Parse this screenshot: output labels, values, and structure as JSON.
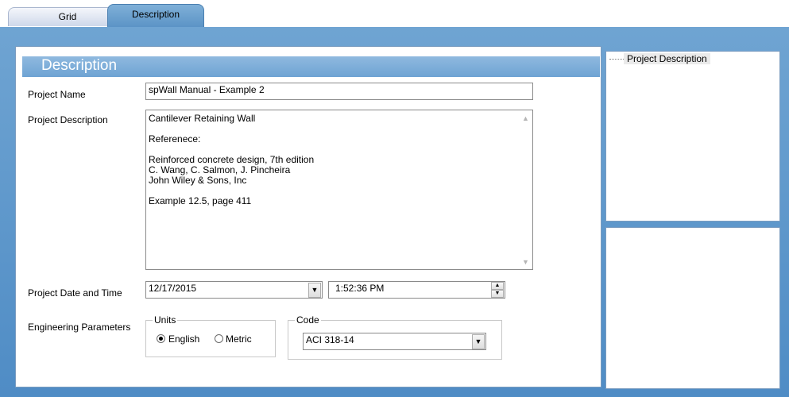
{
  "tabs": [
    {
      "label": "Grid",
      "active": false
    },
    {
      "label": "Description",
      "active": true
    }
  ],
  "section": {
    "title": "Description"
  },
  "form": {
    "project_name_label": "Project Name",
    "project_name_value": "spWall Manual - Example 2",
    "project_description_label": "Project Description",
    "project_description_value": "Cantilever Retaining Wall\n\nReferenece:\n\nReinforced concrete design, 7th edition\nC. Wang, C. Salmon, J. Pincheira\nJohn Wiley & Sons, Inc\n\nExample 12.5, page 411",
    "date_time_label": "Project Date and Time",
    "date_value": "12/17/2015",
    "time_value": "1:52:36 PM",
    "engineering_label": "Engineering Parameters",
    "units": {
      "legend": "Units",
      "options": [
        "English",
        "Metric"
      ],
      "selected": "English"
    },
    "code": {
      "legend": "Code",
      "selected": "ACI 318-14"
    }
  },
  "tree": {
    "items": [
      "Project Description"
    ]
  },
  "colors": {
    "frame": "#5b96cb",
    "header": "#7eb0dc",
    "tab_active": "#6a9fd0"
  },
  "icons": {
    "dropdown": "chevron-down-icon",
    "spin_up": "spin-up-icon",
    "spin_down": "spin-down-icon"
  }
}
